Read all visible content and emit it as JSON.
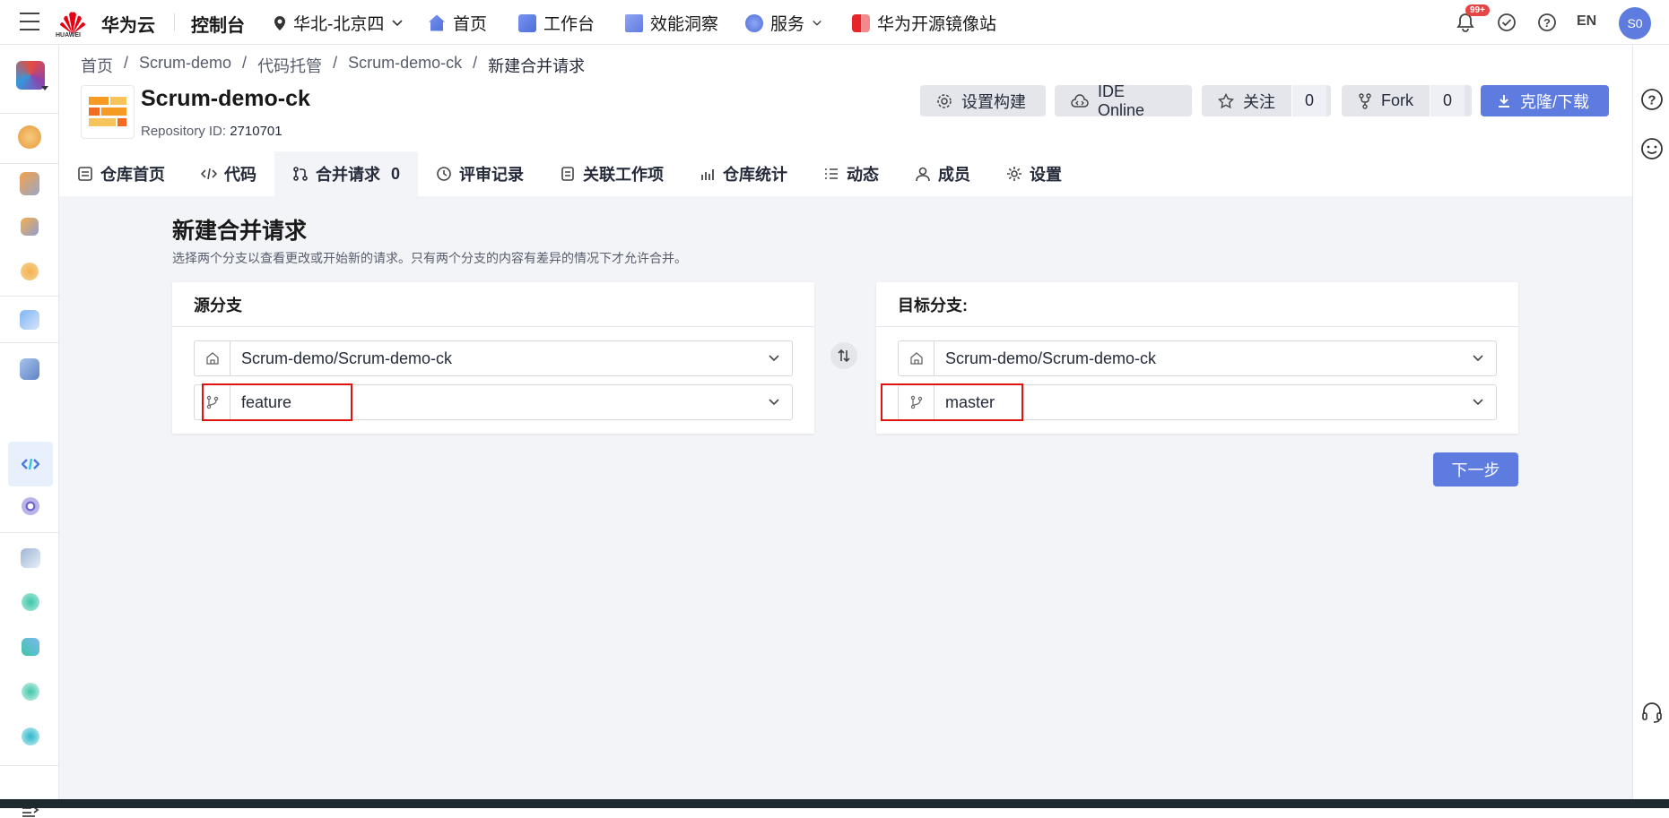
{
  "topbar": {
    "brand": "华为云",
    "logo_text": "HUAWEI",
    "console": "控制台",
    "region": "华北-北京四",
    "nav": [
      {
        "label": "首页",
        "icon": "home-icon"
      },
      {
        "label": "工作台",
        "icon": "workbench-icon"
      },
      {
        "label": "效能洞察",
        "icon": "insight-icon"
      },
      {
        "label": "服务",
        "icon": "service-icon"
      },
      {
        "label": "华为开源镜像站",
        "icon": "mirror-icon"
      }
    ],
    "badge": "99+",
    "lang": "EN",
    "avatar": "S0"
  },
  "breadcrumb": [
    "首页",
    "Scrum-demo",
    "代码托管",
    "Scrum-demo-ck",
    "新建合并请求"
  ],
  "breadcrumb_sep": "/",
  "repo": {
    "name": "Scrum-demo-ck",
    "id_label": "Repository ID:",
    "id": "2710701"
  },
  "actions": {
    "build": "设置构建",
    "ide": "IDE Online",
    "follow": "关注",
    "follow_count": "0",
    "fork": "Fork",
    "fork_count": "0",
    "clone": "克隆/下载"
  },
  "tabs": [
    {
      "label": "仓库首页"
    },
    {
      "label": "代码"
    },
    {
      "label": "合并请求",
      "count": "0"
    },
    {
      "label": "评审记录"
    },
    {
      "label": "关联工作项"
    },
    {
      "label": "仓库统计"
    },
    {
      "label": "动态"
    },
    {
      "label": "成员"
    },
    {
      "label": "设置"
    }
  ],
  "page": {
    "title": "新建合并请求",
    "description": "选择两个分支以查看更改或开始新的请求。只有两个分支的内容有差异的情况下才允许合并。"
  },
  "source": {
    "header": "源分支",
    "repo": "Scrum-demo/Scrum-demo-ck",
    "branch": "feature"
  },
  "target": {
    "header": "目标分支:",
    "repo": "Scrum-demo/Scrum-demo-ck",
    "branch": "master"
  },
  "next_button": "下一步",
  "colors": {
    "primary": "#5e7ce0",
    "highlight": "#e0140e",
    "background": "#f3f4f7"
  }
}
